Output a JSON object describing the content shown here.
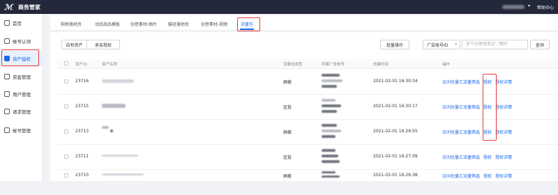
{
  "app": {
    "title": "商务管家",
    "help_label": "帮助中心"
  },
  "sidebar": {
    "items": [
      {
        "label": "首页",
        "icon": "home-icon"
      },
      {
        "label": "帐号认领",
        "icon": "shield-icon"
      },
      {
        "label": "资产授权",
        "icon": "layers-icon",
        "active": true
      },
      {
        "label": "资金管理",
        "icon": "wallet-icon"
      },
      {
        "label": "用户管理",
        "icon": "user-icon"
      },
      {
        "label": "请求管理",
        "icon": "list-icon"
      },
      {
        "label": "帐号管理",
        "icon": "gear-icon"
      }
    ]
  },
  "tabs": [
    {
      "label": "购物落地页"
    },
    {
      "label": "动态商品模板"
    },
    {
      "label": "创意素材-图片"
    },
    {
      "label": "蹊径落地页"
    },
    {
      "label": "创意素材-视频"
    },
    {
      "label": "流量包",
      "active": true
    }
  ],
  "toolbar": {
    "seg_own": "自有资产",
    "seg_other": "来自授权",
    "batch_label": "批量操作",
    "select_value": "广告账号ID",
    "search_placeholder": "多个ID使用英文\",\"隔开",
    "query_label": "查询"
  },
  "table": {
    "columns": [
      "资产ID",
      "资产名称",
      "流量包类型",
      "所属广告帐号",
      "创建时间",
      "操作"
    ],
    "rows": [
      {
        "id": "23716",
        "type": "屏蔽",
        "created": "2021-02-01 16:30:34",
        "op_flow": "访问优量汇流量筛选",
        "op_grant": "授权",
        "op_detail": "授权详情"
      },
      {
        "id": "23715",
        "type": "定投",
        "created": "2021-02-01 16:30:17",
        "op_flow": "访问优量汇流量筛选",
        "op_grant": "授权",
        "op_detail": "授权详情"
      },
      {
        "id": "23713",
        "type": "屏蔽",
        "created": "2021-02-01 16:29:55",
        "op_flow": "访问优量汇流量筛选",
        "op_grant": "授权",
        "op_detail": "授权详情"
      },
      {
        "id": "23711",
        "type": "定投",
        "created": "2021-02-01 16:27:09",
        "op_flow": "访问优量汇流量筛选",
        "op_grant": "授权",
        "op_detail": "授权详情"
      },
      {
        "id": "23710",
        "type": "屏蔽",
        "created": "2021-02-01 16:26:38",
        "op_flow": "访问优量汇流量筛选",
        "op_grant": "授权",
        "op_detail": "授权详情"
      }
    ]
  },
  "colors": {
    "accent": "#1c67e3",
    "highlight": "#e53935",
    "topbar": "#23283a"
  }
}
